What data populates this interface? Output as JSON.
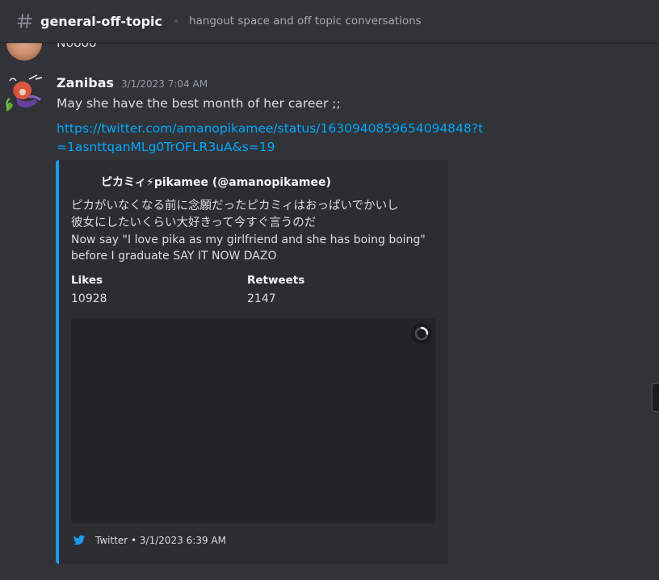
{
  "header": {
    "channel_name": "general-off-topic",
    "topic": "hangout space and off topic conversations",
    "icon": "hash-icon"
  },
  "previous_message": {
    "text": "Noooo"
  },
  "message": {
    "username": "Zanibas",
    "timestamp": "3/1/2023 7:04 AM",
    "text": "May she have the best month of her career ;;",
    "link": "https://twitter.com/amanopikamee/status/1630940859654094848?t=1asnttqanMLg0TrOFLR3uA&s=19"
  },
  "embed": {
    "accent_color": "#1d9bf0",
    "author": "ピカミィ⚡pikamee (@amanopikamee)",
    "desc_jp_line1": "ピカがいなくなる前に念願だったピカミィはおっぱいでかいし",
    "desc_jp_line2": "彼女にしたいくらい大好きって今すぐ言うのだ",
    "desc_en_line1": "Now say \"I love pika as my girlfriend and she has boing boing\"",
    "desc_en_line2": "before I graduate SAY IT NOW DAZO",
    "fields": [
      {
        "name": "Likes",
        "value": "10928"
      },
      {
        "name": "Retweets",
        "value": "2147"
      }
    ],
    "footer": "Twitter • 3/1/2023 6:39 AM",
    "footer_icon": "twitter-icon"
  }
}
